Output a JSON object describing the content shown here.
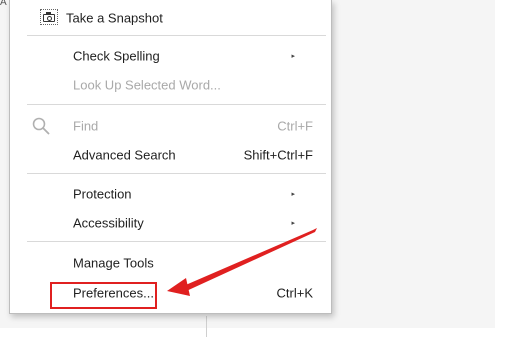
{
  "background": {
    "stub_text": "A"
  },
  "menu": {
    "snapshot": {
      "label": "Take a Snapshot",
      "icon": "camera-icon"
    },
    "check_spelling": {
      "label": "Check Spelling",
      "submenu_marker": "▸"
    },
    "look_up": {
      "label": "Look Up Selected Word..."
    },
    "find": {
      "label": "Find",
      "shortcut": "Ctrl+F",
      "icon": "search-icon"
    },
    "advanced_search": {
      "label": "Advanced Search",
      "shortcut": "Shift+Ctrl+F"
    },
    "protection": {
      "label": "Protection",
      "submenu_marker": "▸"
    },
    "accessibility": {
      "label": "Accessibility",
      "submenu_marker": "▸"
    },
    "manage_tools": {
      "label": "Manage Tools"
    },
    "preferences": {
      "label": "Preferences...",
      "shortcut": "Ctrl+K"
    }
  },
  "annotation": {
    "color": "#e02020"
  }
}
